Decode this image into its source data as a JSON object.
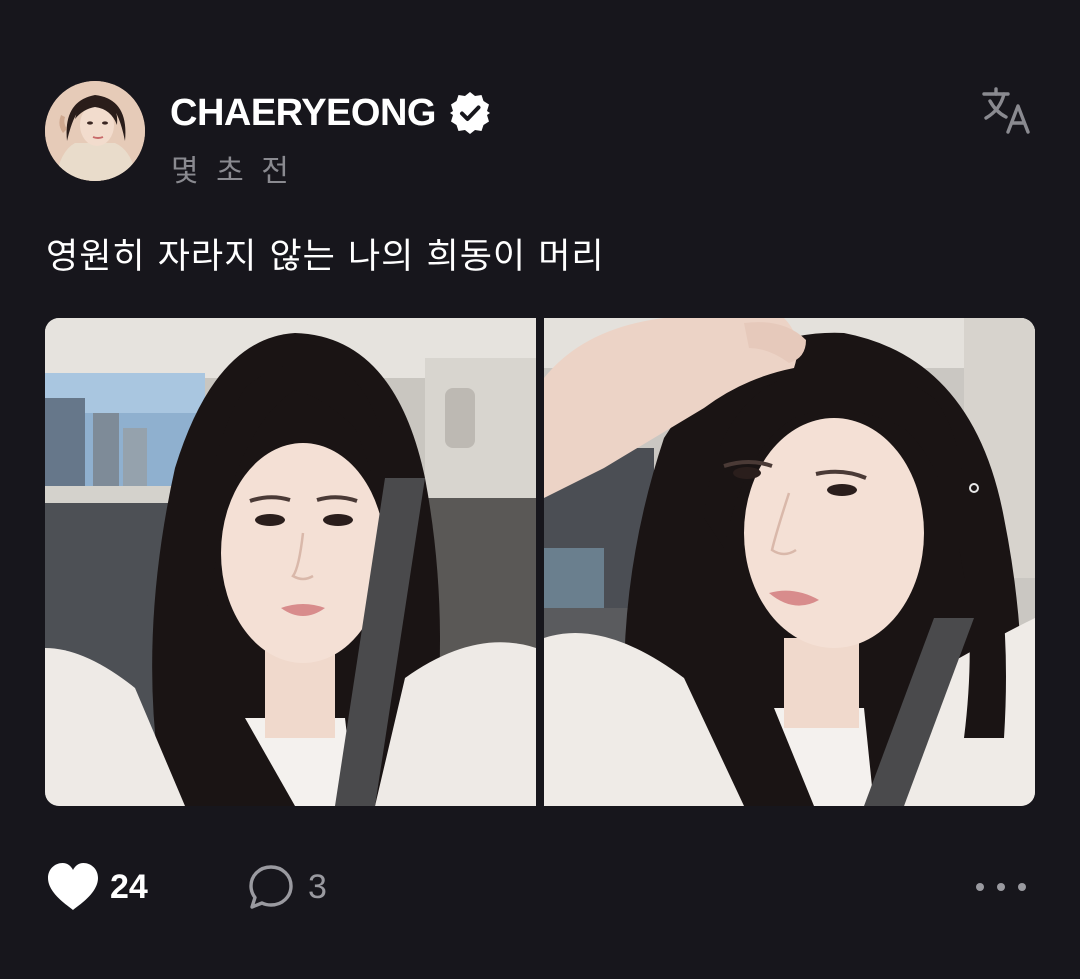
{
  "post": {
    "author": {
      "username": "CHAERYEONG",
      "verified_icon": "verified-badge-icon",
      "avatar": "profile-photo"
    },
    "timestamp": "몇 초 전",
    "caption": "영원히 자라지 않는 나의 희동이 머리",
    "photos": [
      "selfie-in-car-front",
      "selfie-in-car-hand-on-head"
    ],
    "translate_icon": "translate-icon",
    "actions": {
      "like_icon": "heart-filled-icon",
      "like_count": "24",
      "comment_icon": "comment-bubble-icon",
      "comment_count": "3",
      "more_icon": "more-horizontal-icon"
    }
  },
  "colors": {
    "background": "#17161c",
    "text_primary": "#ffffff",
    "text_secondary": "#8a8a90"
  }
}
